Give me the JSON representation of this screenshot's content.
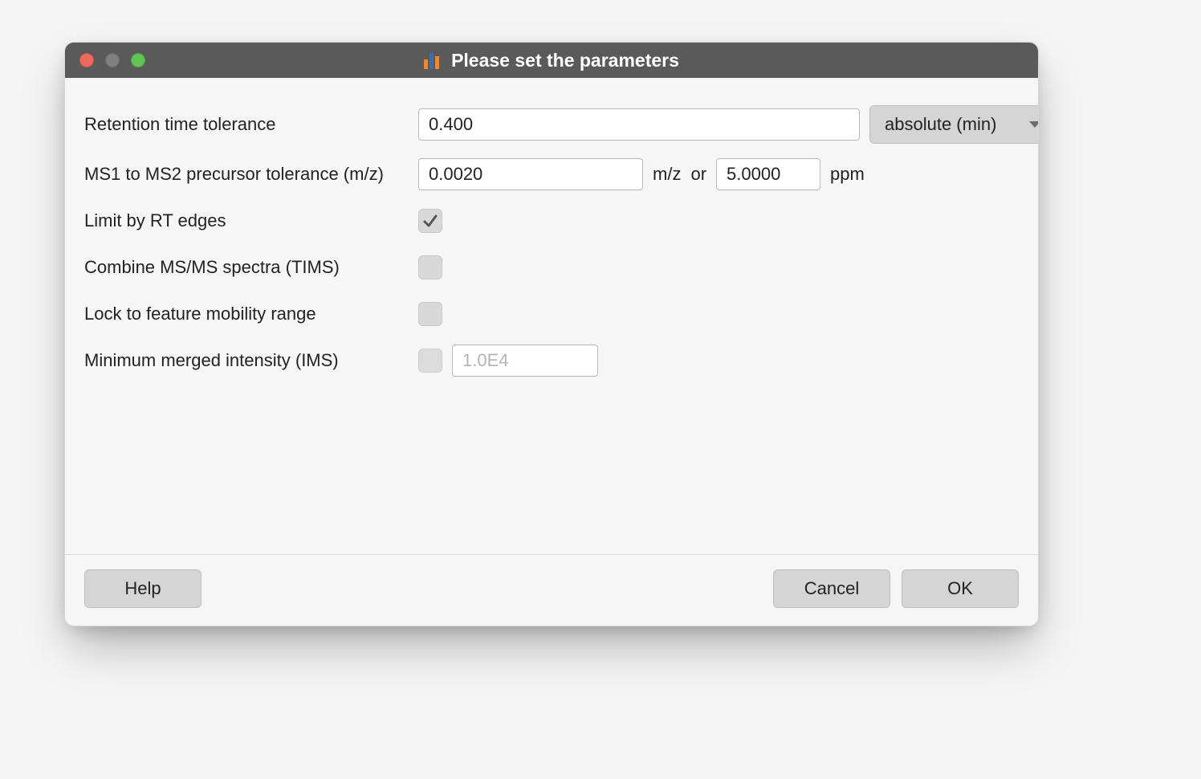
{
  "titlebar": {
    "title": "Please set the parameters"
  },
  "rows": {
    "rt_tolerance": {
      "label": "Retention time tolerance",
      "value": "0.400",
      "unit_selected": "absolute (min)"
    },
    "precursor_tolerance": {
      "label": "MS1 to MS2 precursor tolerance (m/z)",
      "mz_value": "0.0020",
      "mz_unit": "m/z",
      "or_text": "or",
      "ppm_value": "5.0000",
      "ppm_unit": "ppm"
    },
    "limit_rt_edges": {
      "label": "Limit by RT edges",
      "checked": true
    },
    "combine_tims": {
      "label": "Combine MS/MS spectra (TIMS)",
      "checked": false
    },
    "lock_mobility": {
      "label": "Lock to feature mobility range",
      "checked": false
    },
    "min_merged_intensity": {
      "label": "Minimum merged intensity (IMS)",
      "enabled": false,
      "value": "1.0E4"
    }
  },
  "footer": {
    "help": "Help",
    "cancel": "Cancel",
    "ok": "OK"
  }
}
